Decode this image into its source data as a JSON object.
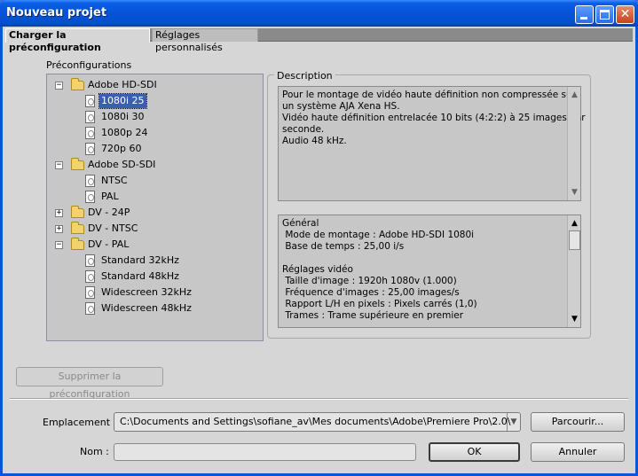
{
  "window": {
    "title": "Nouveau projet"
  },
  "tabs": [
    {
      "label": "Charger la préconfiguration",
      "active": true
    },
    {
      "label": "Réglages personnalisés",
      "active": false
    }
  ],
  "presets": {
    "label": "Préconfigurations",
    "tree": [
      {
        "label": "Adobe HD-SDI",
        "expanded": true,
        "children": [
          "1080i 25",
          "1080i 30",
          "1080p 24",
          "720p 60"
        ]
      },
      {
        "label": "Adobe SD-SDI",
        "expanded": true,
        "children": [
          "NTSC",
          "PAL"
        ]
      },
      {
        "label": "DV - 24P",
        "expanded": false,
        "children": []
      },
      {
        "label": "DV - NTSC",
        "expanded": false,
        "children": []
      },
      {
        "label": "DV - PAL",
        "expanded": true,
        "children": [
          "Standard 32kHz",
          "Standard 48kHz",
          "Widescreen 32kHz",
          "Widescreen 48kHz"
        ]
      }
    ],
    "selected": "1080i 25"
  },
  "description": {
    "legend": "Description",
    "text": "Pour le montage de vidéo haute définition non compressée sur\nun système AJA Xena HS.\nVidéo haute définition entrelacée 10 bits (4:2:2) à 25 images par\nseconde.\nAudio 48 kHz.",
    "details": "Général\n Mode de montage : Adobe HD-SDI 1080i\n Base de temps : 25,00 i/s\n\nRéglages vidéo\n Taille d'image : 1920h 1080v (1.000)\n Fréquence d'images : 25,00 images/s\n Rapport L/H en pixels : Pixels carrés (1,0)\n Trames : Trame supérieure en premier"
  },
  "buttons": {
    "delete_preset": "Supprimer la préconfiguration",
    "browse": "Parcourir...",
    "ok": "OK",
    "cancel": "Annuler"
  },
  "location": {
    "label": "Emplacement :",
    "value": "C:\\Documents and Settings\\sofiane_av\\Mes documents\\Adobe\\Premiere Pro\\2.0\\"
  },
  "name": {
    "label": "Nom :",
    "value": ""
  }
}
